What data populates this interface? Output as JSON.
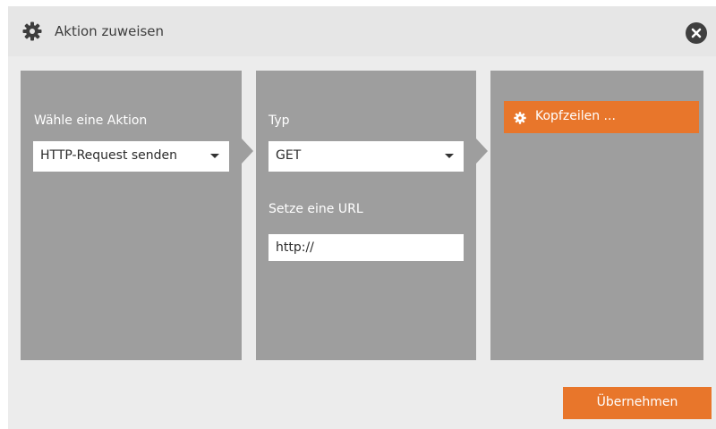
{
  "dialog": {
    "title": "Aktion zuweisen",
    "title_icon": "gear-icon",
    "close_icon": "close-icon"
  },
  "panel_action": {
    "label": "Wähle eine Aktion",
    "select_value": "HTTP-Request senden"
  },
  "panel_request": {
    "type_label": "Typ",
    "type_value": "GET",
    "url_label": "Setze eine URL",
    "url_value": "http://"
  },
  "panel_headers": {
    "button_label": "Kopfzeilen ...",
    "button_icon": "gear-icon"
  },
  "footer": {
    "apply_label": "Übernehmen"
  },
  "colors": {
    "accent": "#e8762b",
    "panel": "#9e9e9e",
    "dialog_bg": "#ececec"
  }
}
